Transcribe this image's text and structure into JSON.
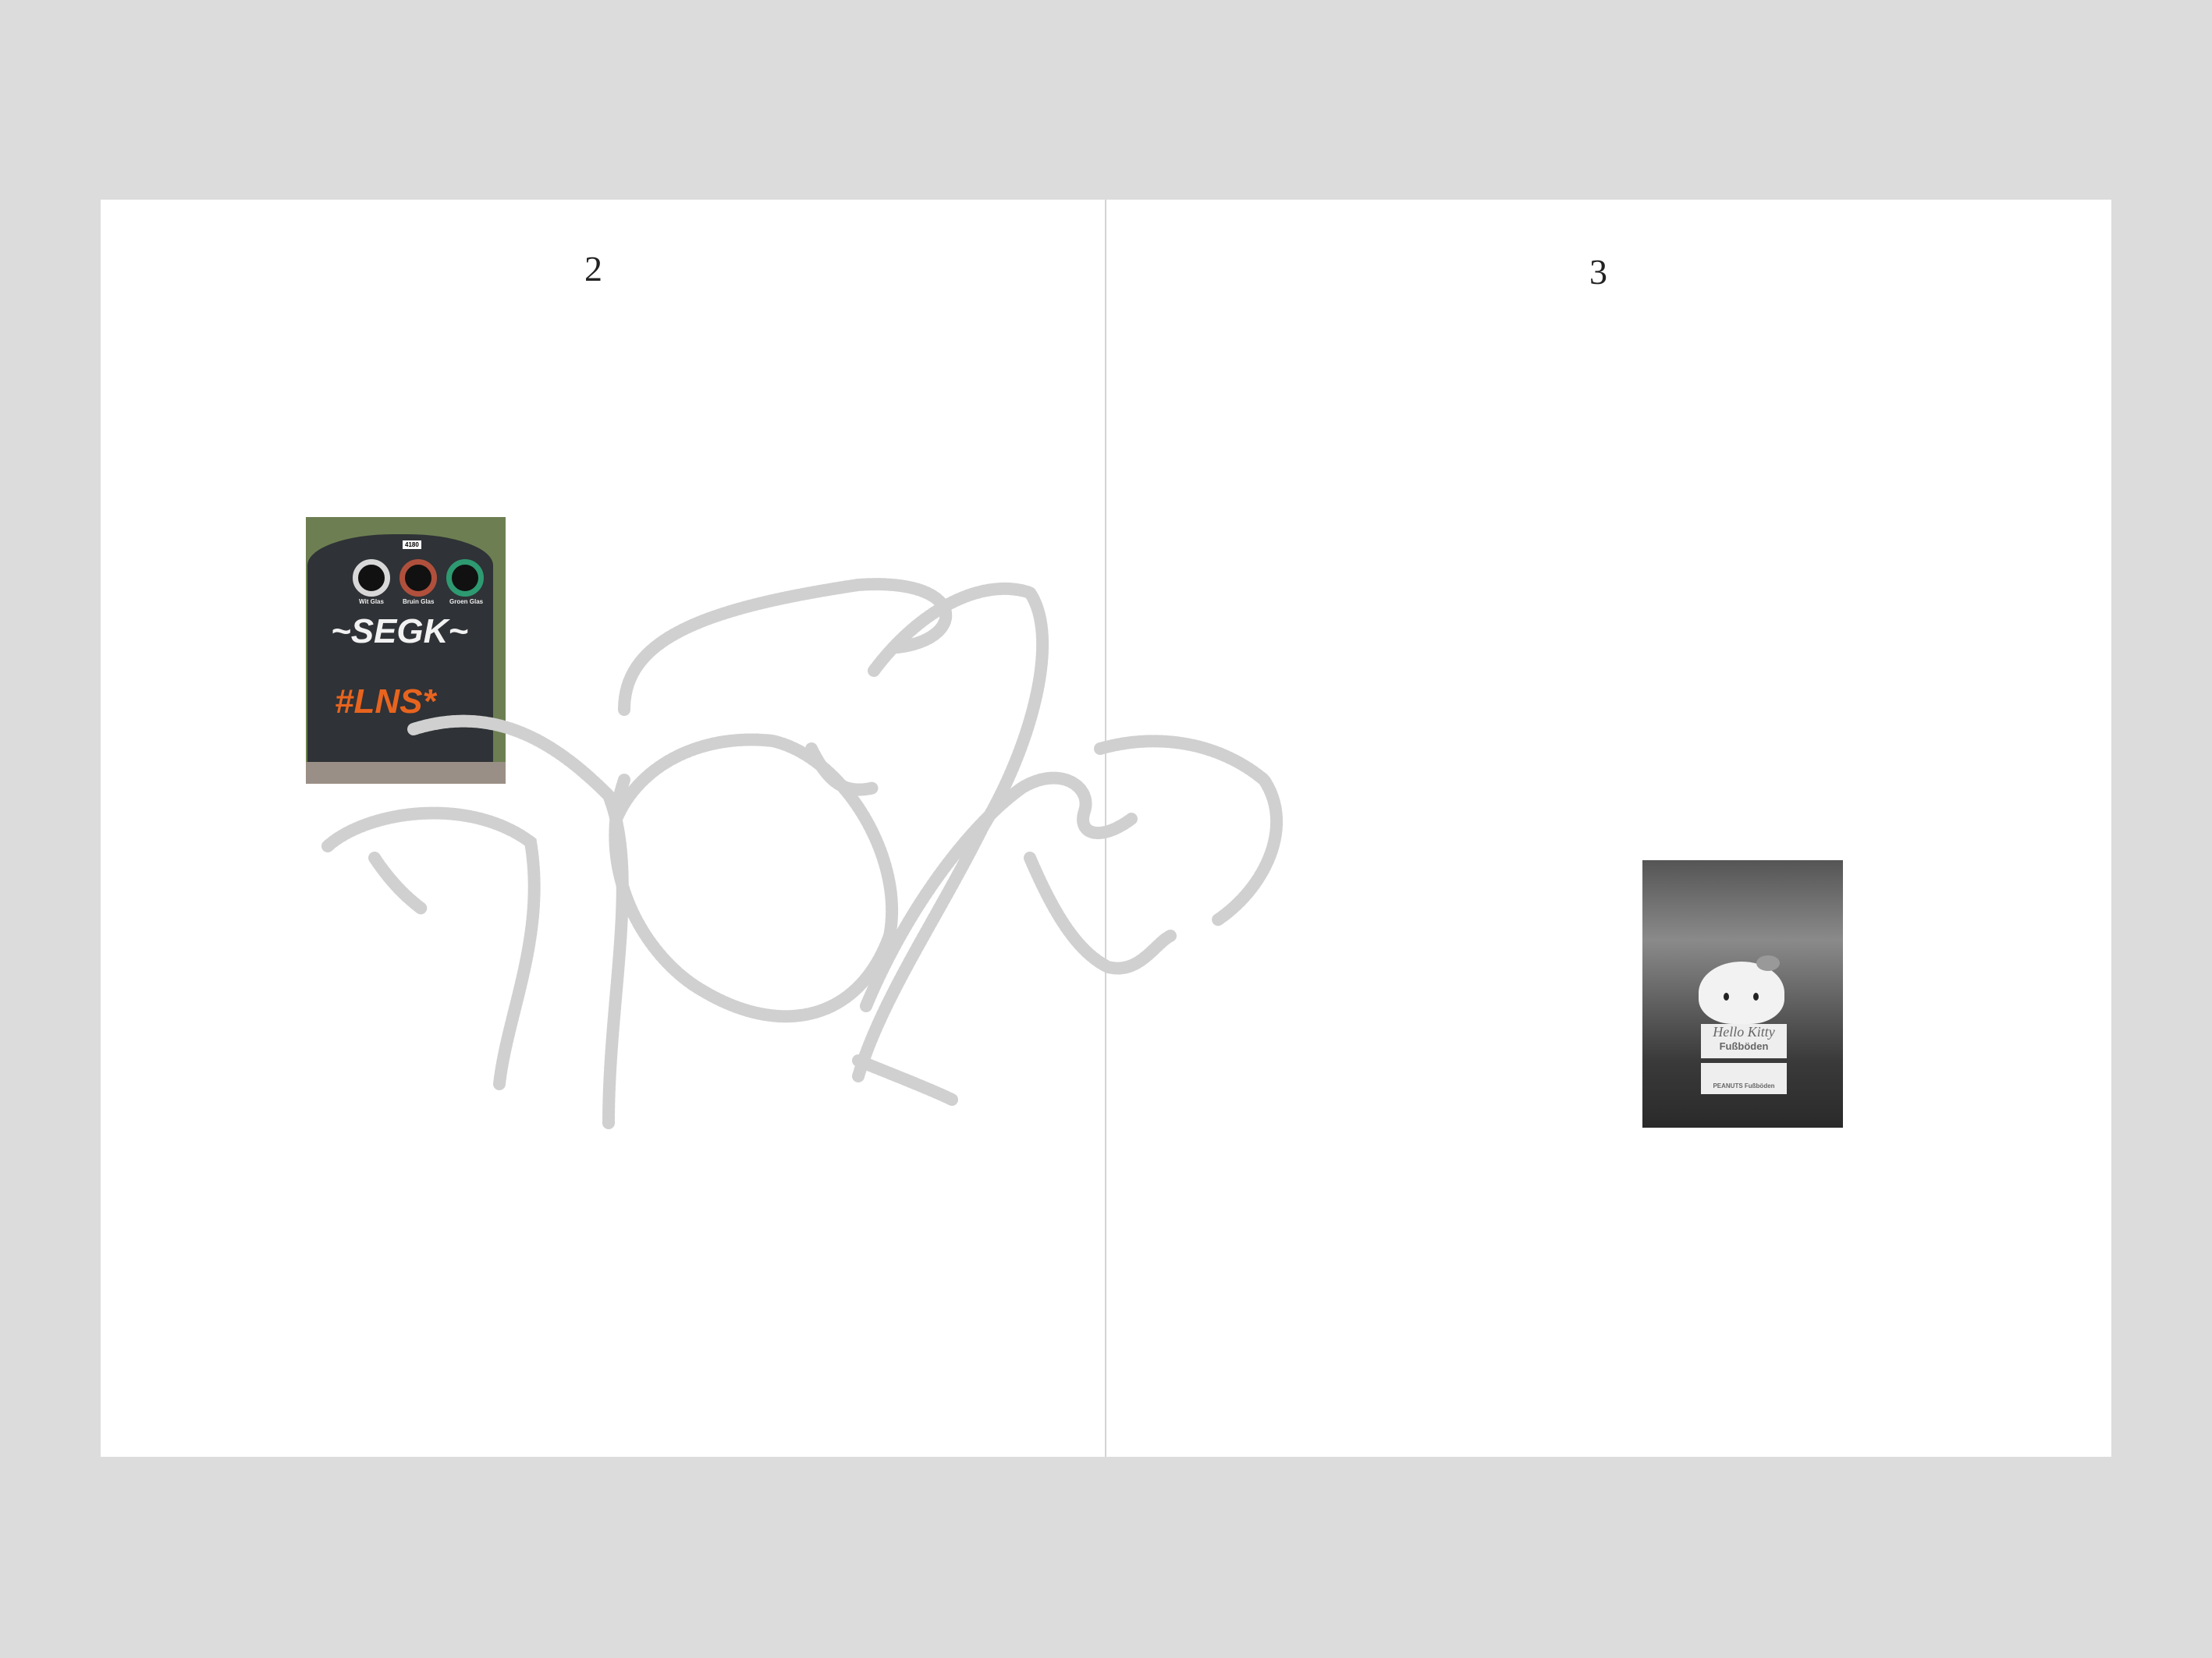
{
  "pages": [
    {
      "number": "2"
    },
    {
      "number": "3"
    }
  ],
  "photo_left": {
    "counter": "4180",
    "labels": [
      "Wit Glas",
      "Bruin Glas",
      "Groen Glas"
    ],
    "colors": {
      "wit": "#d8d8d8",
      "bruin": "#b0503c",
      "groen": "#2e9a72",
      "graffiti_orange": "#e8641e"
    }
  },
  "photo_right": {
    "sign_title": "Hello Kitty",
    "sign_subtitle": "Fußböden",
    "sign_bottom": "PEANUTS Fußböden"
  }
}
